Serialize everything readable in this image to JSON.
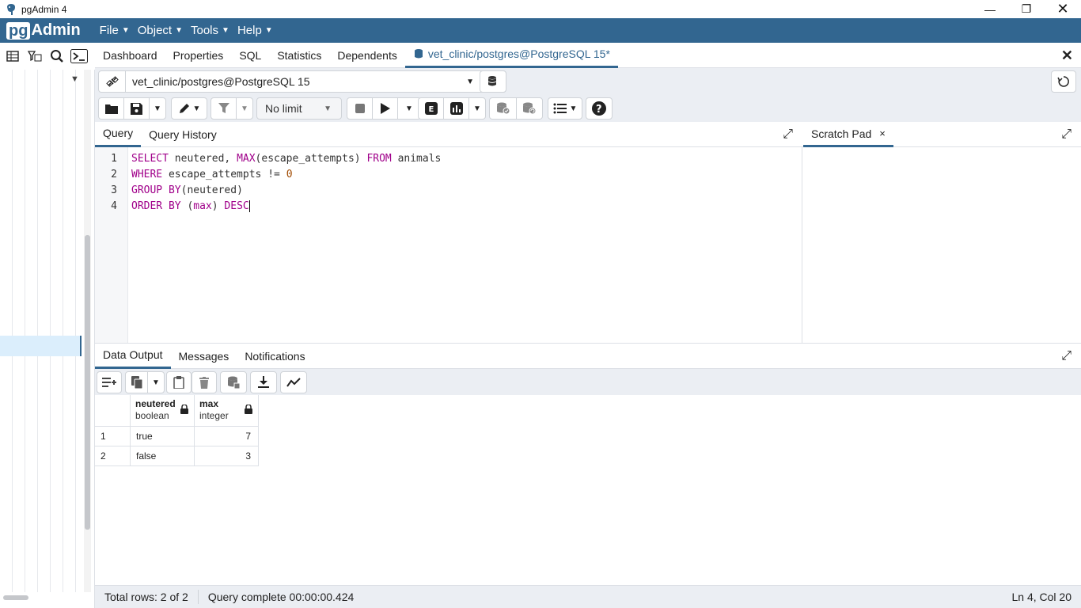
{
  "window": {
    "title": "pgAdmin 4"
  },
  "menubar": {
    "logo_pg": "pg",
    "logo_admin": "Admin",
    "items": [
      "File",
      "Object",
      "Tools",
      "Help"
    ]
  },
  "main_tabs": {
    "items": [
      "Dashboard",
      "Properties",
      "SQL",
      "Statistics",
      "Dependents"
    ],
    "active": "vet_clinic/postgres@PostgreSQL 15*"
  },
  "connection": {
    "value": "vet_clinic/postgres@PostgreSQL 15"
  },
  "toolbar": {
    "limit": "No limit"
  },
  "query_tabs": {
    "query": "Query",
    "history": "Query History"
  },
  "editor": {
    "line_numbers": [
      "1",
      "2",
      "3",
      "4"
    ],
    "lines": [
      [
        {
          "t": "SELECT",
          "k": "kw"
        },
        {
          "t": " neutered, ",
          "k": ""
        },
        {
          "t": "MAX",
          "k": "kw"
        },
        {
          "t": "(escape_attempts) ",
          "k": ""
        },
        {
          "t": "FROM",
          "k": "kw"
        },
        {
          "t": " animals",
          "k": ""
        }
      ],
      [
        {
          "t": "WHERE",
          "k": "kw"
        },
        {
          "t": " escape_attempts != ",
          "k": ""
        },
        {
          "t": "0",
          "k": "num"
        }
      ],
      [
        {
          "t": "GROUP BY",
          "k": "kw"
        },
        {
          "t": "(neutered)",
          "k": ""
        }
      ],
      [
        {
          "t": "ORDER BY",
          "k": "kw"
        },
        {
          "t": " (",
          "k": ""
        },
        {
          "t": "max",
          "k": "kw"
        },
        {
          "t": ") ",
          "k": ""
        },
        {
          "t": "DESC",
          "k": "kw"
        }
      ]
    ]
  },
  "scratch_pad": {
    "title": "Scratch Pad",
    "close": "×"
  },
  "output_tabs": [
    "Data Output",
    "Messages",
    "Notifications"
  ],
  "result_grid": {
    "columns": [
      {
        "name": "neutered",
        "type": "boolean"
      },
      {
        "name": "max",
        "type": "integer"
      }
    ],
    "rows": [
      {
        "num": "1",
        "neutered": "true",
        "max": "7"
      },
      {
        "num": "2",
        "neutered": "false",
        "max": "3"
      }
    ]
  },
  "status": {
    "rows": "Total rows: 2 of 2",
    "query": "Query complete 00:00:00.424",
    "position": "Ln 4, Col 20"
  },
  "colors": {
    "brand": "#326690",
    "keyword": "#a0008a",
    "number": "#a04a00"
  }
}
